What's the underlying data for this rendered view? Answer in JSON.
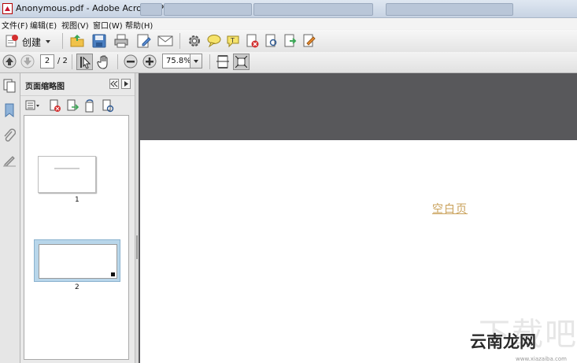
{
  "window": {
    "title": "Anonymous.pdf - Adobe Acrobat Pro"
  },
  "menu": {
    "items": [
      "文件(F)",
      "编辑(E)",
      "视图(V)",
      "窗口(W)",
      "帮助(H)"
    ]
  },
  "toolbar": {
    "create_label": "创建"
  },
  "navigation": {
    "current_page": "2",
    "page_total": "/ 2",
    "zoom": "75.8%"
  },
  "panel": {
    "title": "页面缩略图"
  },
  "thumbnails": [
    {
      "label": "1"
    },
    {
      "label": "2"
    }
  ],
  "document": {
    "link_text": "空白页"
  },
  "watermark": {
    "text": "云南龙网",
    "ghost": "下载吧",
    "url": "www.xiazaiba.com"
  }
}
